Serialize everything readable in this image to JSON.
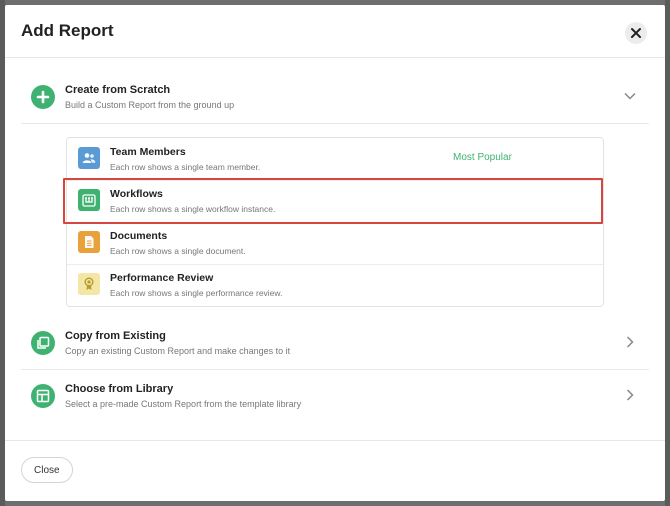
{
  "modal": {
    "title": "Add Report",
    "close_icon": "close-icon"
  },
  "options": [
    {
      "title": "Create from Scratch",
      "description": "Build a Custom Report from the ground up",
      "icon": "plus-circle-icon",
      "expanded": true
    },
    {
      "title": "Copy from Existing",
      "description": "Copy an existing Custom Report and make changes to it",
      "icon": "copy-icon",
      "expanded": false
    },
    {
      "title": "Choose from Library",
      "description": "Select a pre-made Custom Report from the template library",
      "icon": "library-icon",
      "expanded": false
    }
  ],
  "report_types": [
    {
      "title": "Team Members",
      "description": "Each row shows a single team member.",
      "icon": "people-icon",
      "color": "#5b9bd5",
      "badge": "Most Popular",
      "selected": false
    },
    {
      "title": "Workflows",
      "description": "Each row shows a single workflow instance.",
      "icon": "workflow-icon",
      "color": "#3fb272",
      "selected": true
    },
    {
      "title": "Documents",
      "description": "Each row shows a single document.",
      "icon": "document-icon",
      "color": "#e9a23b",
      "selected": false
    },
    {
      "title": "Performance Review",
      "description": "Each row shows a single performance review.",
      "icon": "award-icon",
      "color": "#f3e6a6",
      "selected": false
    }
  ],
  "footer": {
    "close_label": "Close"
  },
  "colors": {
    "accent_green": "#3fb272",
    "highlight_red": "#d6453f"
  }
}
